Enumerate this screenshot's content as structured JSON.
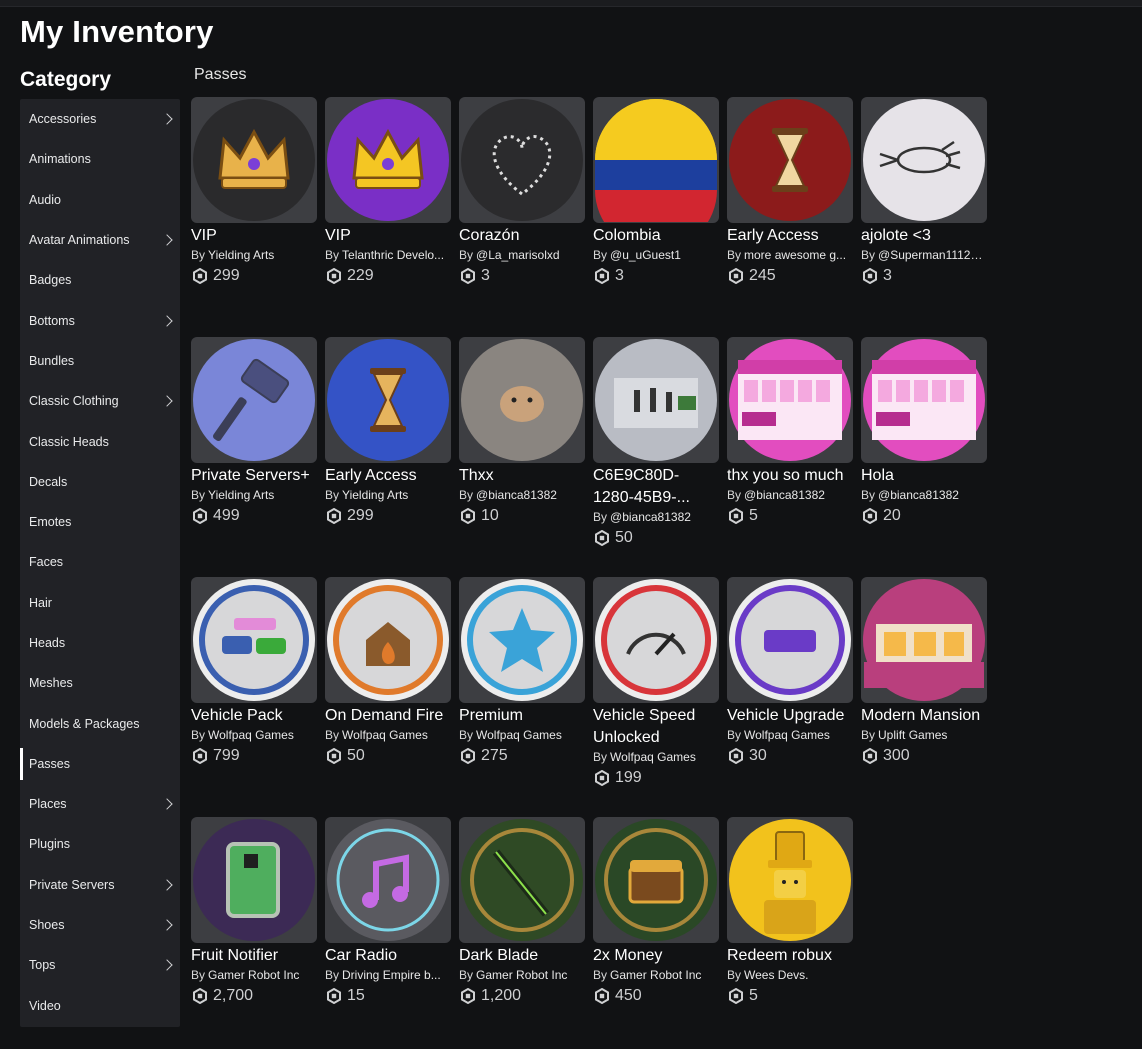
{
  "page_title": "My Inventory",
  "category_title": "Category",
  "section_title": "Passes",
  "creator_prefix": "By",
  "sidebar": [
    {
      "label": "Accessories",
      "chevron": true
    },
    {
      "label": "Animations",
      "chevron": false
    },
    {
      "label": "Audio",
      "chevron": false
    },
    {
      "label": "Avatar Animations",
      "chevron": true
    },
    {
      "label": "Badges",
      "chevron": false
    },
    {
      "label": "Bottoms",
      "chevron": true
    },
    {
      "label": "Bundles",
      "chevron": false
    },
    {
      "label": "Classic Clothing",
      "chevron": true
    },
    {
      "label": "Classic Heads",
      "chevron": false
    },
    {
      "label": "Decals",
      "chevron": false
    },
    {
      "label": "Emotes",
      "chevron": false
    },
    {
      "label": "Faces",
      "chevron": false
    },
    {
      "label": "Hair",
      "chevron": false
    },
    {
      "label": "Heads",
      "chevron": false
    },
    {
      "label": "Meshes",
      "chevron": false
    },
    {
      "label": "Models & Packages",
      "chevron": false
    },
    {
      "label": "Passes",
      "chevron": false,
      "active": true
    },
    {
      "label": "Places",
      "chevron": true
    },
    {
      "label": "Plugins",
      "chevron": false
    },
    {
      "label": "Private Servers",
      "chevron": true
    },
    {
      "label": "Shoes",
      "chevron": true
    },
    {
      "label": "Tops",
      "chevron": true
    },
    {
      "label": "Video",
      "chevron": false
    }
  ],
  "items": [
    {
      "name": "VIP",
      "creator": "Yielding Arts",
      "price": "299",
      "icon": "crown-gold-icon",
      "bg": "#2a2a2c",
      "fg": "#e8b24a"
    },
    {
      "name": "VIP",
      "creator": "Telanthric Develo...",
      "price": "229",
      "icon": "crown-purple-icon",
      "bg": "#7a2fc6",
      "fg": "#f4c623"
    },
    {
      "name": "Corazón",
      "creator": "@La_marisolxd",
      "price": "3",
      "icon": "heart-lights-icon",
      "bg": "#2b2b2d",
      "fg": "#dddddd"
    },
    {
      "name": "Colombia",
      "creator": "@u_uGuest1",
      "price": "3",
      "icon": "colombia-flag-icon",
      "bg": "#f5cb1f",
      "fg": "#1d3f9e"
    },
    {
      "name": "Early Access",
      "creator": "more awesome g...",
      "price": "245",
      "icon": "hourglass-red-icon",
      "bg": "#8c1b1b",
      "fg": "#f0d7a0"
    },
    {
      "name": "ajolote <3",
      "creator": "@Superman11123...",
      "price": "3",
      "icon": "axolotl-icon",
      "bg": "#e6e3e8",
      "fg": "#333333"
    },
    {
      "name": "Private Servers+",
      "creator": "Yielding Arts",
      "price": "499",
      "icon": "hammer-icon",
      "bg": "#7a86d8",
      "fg": "#3b3e57"
    },
    {
      "name": "Early Access",
      "creator": "Yielding Arts",
      "price": "299",
      "icon": "hourglass-blue-icon",
      "bg": "#3453c6",
      "fg": "#e6b45d"
    },
    {
      "name": "Thxx",
      "creator": "@bianca81382",
      "price": "10",
      "icon": "hamster-photo-icon",
      "bg": "#8a8580",
      "fg": "#c9a27b"
    },
    {
      "name": "C6E9C80D-1280-45B9-...",
      "creator": "@bianca81382",
      "price": "50",
      "icon": "game-screenshot-icon",
      "bg": "#b9bcc4",
      "fg": "#3d7a3a"
    },
    {
      "name": "thx you so much",
      "creator": "@bianca81382",
      "price": "5",
      "icon": "rewards-screen-icon",
      "bg": "#e24dbf",
      "fg": "#fbe7f5"
    },
    {
      "name": "Hola",
      "creator": "@bianca81382",
      "price": "20",
      "icon": "rewards-screen-icon",
      "bg": "#e24dbf",
      "fg": "#fbe7f5"
    },
    {
      "name": "Vehicle Pack",
      "creator": "Wolfpaq Games",
      "price": "799",
      "icon": "vehicle-pack-badge-icon",
      "bg": "#ededed",
      "fg": "#3a5fb0"
    },
    {
      "name": "On Demand Fire",
      "creator": "Wolfpaq Games",
      "price": "50",
      "icon": "house-fire-badge-icon",
      "bg": "#ededed",
      "fg": "#e07a2b"
    },
    {
      "name": "Premium",
      "creator": "Wolfpaq Games",
      "price": "275",
      "icon": "star-badge-icon",
      "bg": "#ededed",
      "fg": "#3aa3d8"
    },
    {
      "name": "Vehicle Speed Unlocked",
      "creator": "Wolfpaq Games",
      "price": "199",
      "icon": "speedometer-badge-icon",
      "bg": "#ededed",
      "fg": "#d8353a"
    },
    {
      "name": "Vehicle Upgrade",
      "creator": "Wolfpaq Games",
      "price": "30",
      "icon": "upgrade-badge-icon",
      "bg": "#ededed",
      "fg": "#6a3bc7"
    },
    {
      "name": "Modern Mansion",
      "creator": "Uplift Games",
      "price": "300",
      "icon": "mansion-icon",
      "bg": "#b93f7d",
      "fg": "#ffffff"
    },
    {
      "name": "Fruit Notifier",
      "creator": "Gamer Robot Inc",
      "price": "2,700",
      "icon": "map-card-icon",
      "bg": "#3c2a55",
      "fg": "#4fae5e"
    },
    {
      "name": "Car Radio",
      "creator": "Driving Empire b...",
      "price": "15",
      "icon": "music-note-icon",
      "bg": "#5a5a60",
      "fg": "#c46ae3"
    },
    {
      "name": "Dark Blade",
      "creator": "Gamer Robot Inc",
      "price": "1,200",
      "icon": "sword-icon",
      "bg": "#2f4a25",
      "fg": "#8ce04b"
    },
    {
      "name": "2x Money",
      "creator": "Gamer Robot Inc",
      "price": "450",
      "icon": "treasure-chest-icon",
      "bg": "#2a4826",
      "fg": "#e2a93b"
    },
    {
      "name": "Redeem robux",
      "creator": "Wees Devs.",
      "price": "5",
      "icon": "gold-avatar-icon",
      "bg": "#f2c21c",
      "fg": "#7a5b10"
    }
  ]
}
